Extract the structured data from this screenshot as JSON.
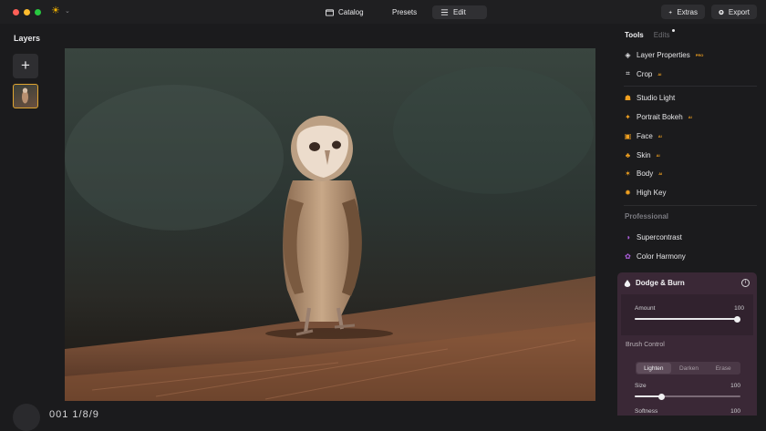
{
  "topbar": {
    "nav": [
      {
        "label": "Catalog",
        "icon": "folder-icon"
      },
      {
        "label": "Presets",
        "icon": "sparkle-icon"
      },
      {
        "label": "Edit",
        "icon": "sliders-icon"
      }
    ],
    "extras_label": "Extras",
    "export_label": "Export"
  },
  "layers": {
    "title": "Layers"
  },
  "bottom": {
    "readout": "001 1/8/9"
  },
  "panel": {
    "tab_tools": "Tools",
    "tab_edits": "Edits",
    "tools": [
      {
        "label": "Layer Properties",
        "badge": "PRO",
        "icon": "layers-icon"
      },
      {
        "label": "Crop",
        "badge": "AI",
        "icon": "crop-icon"
      },
      {
        "label": "Studio Light",
        "badge": "",
        "icon": "studio-light-icon"
      },
      {
        "label": "Portrait Bokeh",
        "badge": "AI",
        "icon": "portrait-bokeh-icon"
      },
      {
        "label": "Face",
        "badge": "AI",
        "icon": "face-icon"
      },
      {
        "label": "Skin",
        "badge": "AI",
        "icon": "skin-icon"
      },
      {
        "label": "Body",
        "badge": "AI",
        "icon": "body-icon"
      },
      {
        "label": "High Key",
        "badge": "",
        "icon": "high-key-icon"
      }
    ],
    "professional_label": "Professional",
    "pro_tools": [
      {
        "label": "Supercontrast",
        "icon": "supercontrast-icon"
      },
      {
        "label": "Color Harmony",
        "icon": "color-harmony-icon"
      }
    ],
    "dodge": {
      "title": "Dodge & Burn",
      "amount_label": "Amount",
      "amount_value": "100",
      "amount_level": 1.0,
      "brush_control_label": "Brush Control",
      "modes": [
        "Lighten",
        "Darken",
        "Erase"
      ],
      "active_mode": "Lighten",
      "size_label": "Size",
      "size_value": "100",
      "size_level": 0.25,
      "softness_label": "Softness",
      "softness_value": "100"
    }
  },
  "colors": {
    "accent": "#f0a020",
    "dodge_bg": "#3a2836",
    "thumb_border": "#e0a530"
  }
}
